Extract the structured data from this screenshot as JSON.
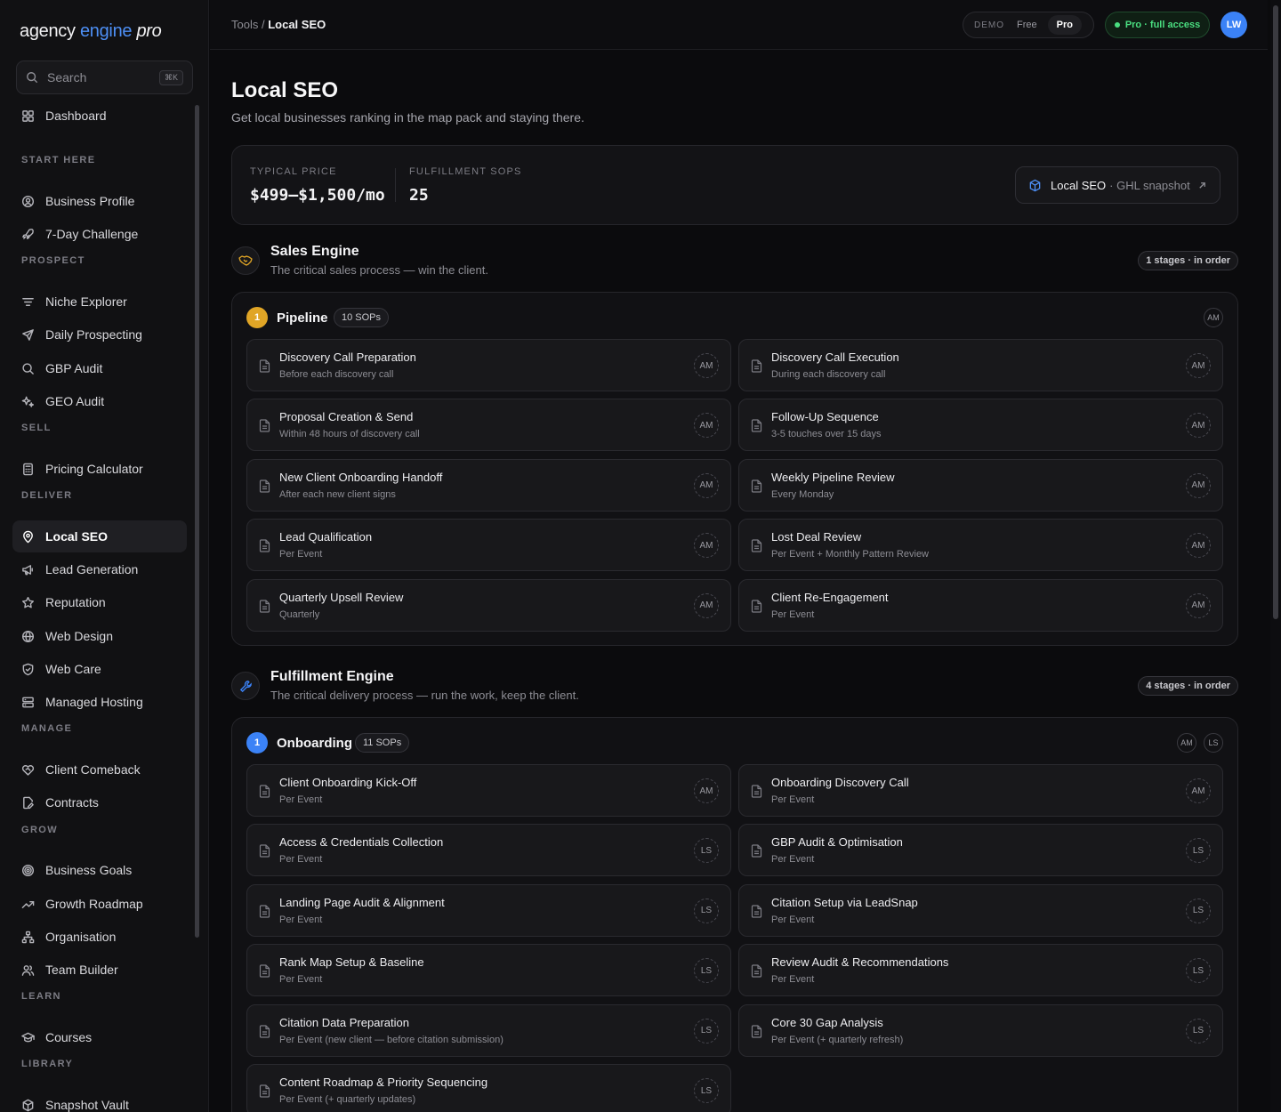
{
  "app": {
    "logo": {
      "part1": "agency ",
      "part2": "engine",
      "part3": " pro"
    },
    "search": {
      "label": "Search",
      "shortcut": "⌘K"
    }
  },
  "sidebar": {
    "items": [
      {
        "label": "Dashboard",
        "icon": "grid-icon"
      },
      {
        "section": "START HERE"
      },
      {
        "label": "Business Profile",
        "icon": "user-circle-icon"
      },
      {
        "label": "7-Day Challenge",
        "icon": "rocket-icon"
      },
      {
        "section": "PROSPECT"
      },
      {
        "label": "Niche Explorer",
        "icon": "filter-icon"
      },
      {
        "label": "Daily Prospecting",
        "icon": "send-icon"
      },
      {
        "label": "GBP Audit",
        "icon": "search-icon"
      },
      {
        "label": "GEO Audit",
        "icon": "sparkles-icon"
      },
      {
        "section": "SELL"
      },
      {
        "label": "Pricing Calculator",
        "icon": "calculator-icon"
      },
      {
        "section": "DELIVER"
      },
      {
        "label": "Local SEO",
        "icon": "map-pin-icon",
        "active": true
      },
      {
        "label": "Lead Generation",
        "icon": "megaphone-icon"
      },
      {
        "label": "Reputation",
        "icon": "star-icon"
      },
      {
        "label": "Web Design",
        "icon": "globe-icon"
      },
      {
        "label": "Web Care",
        "icon": "shield-icon"
      },
      {
        "label": "Managed Hosting",
        "icon": "server-icon"
      },
      {
        "section": "MANAGE"
      },
      {
        "label": "Client Comeback",
        "icon": "heart-handshake-icon"
      },
      {
        "label": "Contracts",
        "icon": "file-edit-icon"
      },
      {
        "section": "GROW"
      },
      {
        "label": "Business Goals",
        "icon": "target-icon"
      },
      {
        "label": "Growth Roadmap",
        "icon": "trending-up-icon"
      },
      {
        "label": "Organisation",
        "icon": "org-chart-icon"
      },
      {
        "label": "Team Builder",
        "icon": "users-icon"
      },
      {
        "section": "LEARN"
      },
      {
        "label": "Courses",
        "icon": "graduation-cap-icon"
      },
      {
        "section": "LIBRARY"
      },
      {
        "label": "Snapshot Vault",
        "icon": "box-icon"
      }
    ]
  },
  "topbar": {
    "breadcrumb": {
      "parent": "Tools",
      "separator": " / ",
      "current": "Local SEO"
    },
    "plan": {
      "demo": "DEMO",
      "free": "Free",
      "pro": "Pro"
    },
    "access": "Pro · full access",
    "avatar": "LW"
  },
  "page": {
    "title": "Local SEO",
    "subtitle": "Get local businesses ranking in the map pack and staying there.",
    "stats": [
      {
        "label": "TYPICAL PRICE",
        "value": "$499–$1,500/mo"
      },
      {
        "label": "FULFILLMENT SOPS",
        "value": "25"
      }
    ],
    "snapshot": {
      "name": "Local SEO",
      "suffix": "· GHL snapshot"
    }
  },
  "engines": [
    {
      "title": "Sales Engine",
      "subtitle": "The critical sales process — win the client.",
      "badge": "1 stages · in order",
      "icon": "handshake-icon",
      "accent": "#e0a526",
      "stage": {
        "num": "1",
        "title": "Pipeline",
        "count": "10 SOPs",
        "owners": [
          "AM"
        ],
        "sops": [
          {
            "title": "Discovery Call Preparation",
            "sub": "Before each discovery call",
            "owner": "AM"
          },
          {
            "title": "Discovery Call Execution",
            "sub": "During each discovery call",
            "owner": "AM"
          },
          {
            "title": "Proposal Creation & Send",
            "sub": "Within 48 hours of discovery call",
            "owner": "AM"
          },
          {
            "title": "Follow-Up Sequence",
            "sub": "3-5 touches over 15 days",
            "owner": "AM"
          },
          {
            "title": "New Client Onboarding Handoff",
            "sub": "After each new client signs",
            "owner": "AM"
          },
          {
            "title": "Weekly Pipeline Review",
            "sub": "Every Monday",
            "owner": "AM"
          },
          {
            "title": "Lead Qualification",
            "sub": "Per Event",
            "owner": "AM"
          },
          {
            "title": "Lost Deal Review",
            "sub": "Per Event + Monthly Pattern Review",
            "owner": "AM"
          },
          {
            "title": "Quarterly Upsell Review",
            "sub": "Quarterly",
            "owner": "AM"
          },
          {
            "title": "Client Re-Engagement",
            "sub": "Per Event",
            "owner": "AM"
          }
        ]
      }
    },
    {
      "title": "Fulfillment Engine",
      "subtitle": "The critical delivery process — run the work, keep the client.",
      "badge": "4 stages · in order",
      "icon": "wrench-icon",
      "accent": "#3b82f6",
      "stage": {
        "num": "1",
        "title": "Onboarding",
        "count": "11 SOPs",
        "owners": [
          "AM",
          "LS"
        ],
        "sops": [
          {
            "title": "Client Onboarding Kick-Off",
            "sub": "Per Event",
            "owner": "AM"
          },
          {
            "title": "Onboarding Discovery Call",
            "sub": "Per Event",
            "owner": "AM"
          },
          {
            "title": "Access & Credentials Collection",
            "sub": "Per Event",
            "owner": "LS"
          },
          {
            "title": "GBP Audit & Optimisation",
            "sub": "Per Event",
            "owner": "LS"
          },
          {
            "title": "Landing Page Audit & Alignment",
            "sub": "Per Event",
            "owner": "LS"
          },
          {
            "title": "Citation Setup via LeadSnap",
            "sub": "Per Event",
            "owner": "LS"
          },
          {
            "title": "Rank Map Setup & Baseline",
            "sub": "Per Event",
            "owner": "LS"
          },
          {
            "title": "Review Audit & Recommendations",
            "sub": "Per Event",
            "owner": "LS"
          },
          {
            "title": "Citation Data Preparation",
            "sub": "Per Event (new client — before citation submission)",
            "owner": "LS"
          },
          {
            "title": "Core 30 Gap Analysis",
            "sub": "Per Event (+ quarterly refresh)",
            "owner": "LS"
          },
          {
            "title": "Content Roadmap & Priority Sequencing",
            "sub": "Per Event (+ quarterly updates)",
            "owner": "LS"
          }
        ]
      }
    }
  ]
}
